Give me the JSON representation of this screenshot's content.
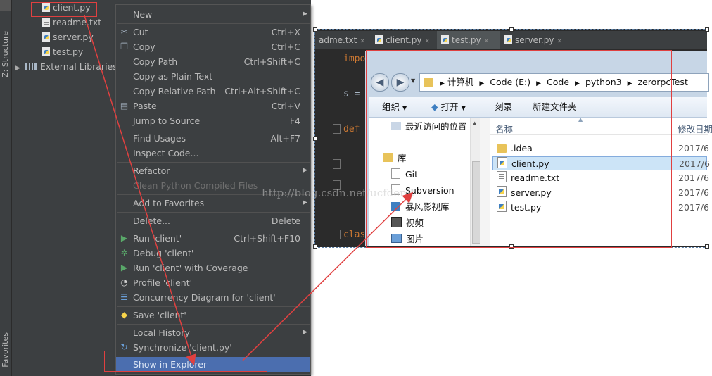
{
  "project_tree": {
    "items": [
      {
        "label": "client.py",
        "icon": "python-file-icon"
      },
      {
        "label": "readme.txt",
        "icon": "text-file-icon"
      },
      {
        "label": "server.py",
        "icon": "python-file-icon"
      },
      {
        "label": "test.py",
        "icon": "python-file-icon"
      },
      {
        "label": "External Libraries",
        "icon": "library-icon"
      }
    ]
  },
  "side_tabs": {
    "structure": "Z: Structure",
    "favorites": "Favorites"
  },
  "context_menu": {
    "items": [
      {
        "label": "New",
        "shortcut": "",
        "submenu": true
      },
      {
        "label": "Cut",
        "shortcut": "Ctrl+X",
        "icon": "scissors-icon"
      },
      {
        "label": "Copy",
        "shortcut": "Ctrl+C",
        "icon": "copy-icon"
      },
      {
        "label": "Copy Path",
        "shortcut": "Ctrl+Shift+C"
      },
      {
        "label": "Copy as Plain Text",
        "shortcut": ""
      },
      {
        "label": "Copy Relative Path",
        "shortcut": "Ctrl+Alt+Shift+C"
      },
      {
        "label": "Paste",
        "shortcut": "Ctrl+V",
        "icon": "paste-icon"
      },
      {
        "label": "Jump to Source",
        "shortcut": "F4"
      },
      {
        "label": "Find Usages",
        "shortcut": "Alt+F7"
      },
      {
        "label": "Inspect Code...",
        "shortcut": ""
      },
      {
        "label": "Refactor",
        "shortcut": "",
        "submenu": true
      },
      {
        "label": "Clean Python Compiled Files",
        "shortcut": "",
        "disabled": true
      },
      {
        "label": "Add to Favorites",
        "shortcut": "",
        "submenu": true
      },
      {
        "label": "Delete...",
        "shortcut": "Delete"
      },
      {
        "label": "Run 'client'",
        "shortcut": "Ctrl+Shift+F10",
        "icon": "run-icon"
      },
      {
        "label": "Debug 'client'",
        "shortcut": "",
        "icon": "debug-icon"
      },
      {
        "label": "Run 'client' with Coverage",
        "shortcut": "",
        "icon": "coverage-icon"
      },
      {
        "label": "Profile 'client'",
        "shortcut": "",
        "icon": "profile-icon"
      },
      {
        "label": "Concurrency Diagram for  'client'",
        "shortcut": "",
        "icon": "concurrency-icon"
      },
      {
        "label": "Save 'client'",
        "shortcut": "",
        "icon": "python-icon"
      },
      {
        "label": "Local History",
        "shortcut": "",
        "submenu": true
      },
      {
        "label": "Synchronize 'client.py'",
        "shortcut": "",
        "icon": "sync-icon"
      },
      {
        "label": "Show in Explorer",
        "shortcut": "",
        "selected": true
      }
    ]
  },
  "editor": {
    "tabs": [
      {
        "label": "adme.txt",
        "icon": "text-file-icon"
      },
      {
        "label": "client.py",
        "icon": "python-file-icon"
      },
      {
        "label": "test.py",
        "icon": "python-file-icon",
        "active": true
      },
      {
        "label": "server.py",
        "icon": "python-file-icon"
      }
    ],
    "code_fragments": [
      "impo",
      "s =",
      "def",
      "clas"
    ]
  },
  "explorer": {
    "breadcrumb": [
      "计算机",
      "Code (E:)",
      "Code",
      "python3",
      "zerorpcTest"
    ],
    "toolbar": {
      "organize": "组织",
      "open": "打开",
      "burn": "刻录",
      "new_folder": "新建文件夹"
    },
    "nav_items": [
      {
        "label": "最近访问的位置",
        "icon": "recent-places-icon"
      },
      {
        "label": "库",
        "icon": "library-folder-icon"
      },
      {
        "label": "Git",
        "icon": "document-icon"
      },
      {
        "label": "Subversion",
        "icon": "document-icon"
      },
      {
        "label": "暴风影视库",
        "icon": "video-library-icon"
      },
      {
        "label": "视频",
        "icon": "video-icon"
      },
      {
        "label": "图片",
        "icon": "picture-icon"
      }
    ],
    "column_name": "名称",
    "column_date": "修改日期",
    "files": [
      {
        "name": ".idea",
        "date": "2017/6",
        "type": "folder"
      },
      {
        "name": "client.py",
        "date": "2017/6",
        "type": "py",
        "selected": true
      },
      {
        "name": "readme.txt",
        "date": "2017/6",
        "type": "txt"
      },
      {
        "name": "server.py",
        "date": "2017/6",
        "type": "py"
      },
      {
        "name": "test.py",
        "date": "2017/6",
        "type": "py"
      }
    ]
  },
  "watermark": "http://blog.csdn.net/ucfdenR",
  "colors": {
    "ide_bg": "#3c3f41",
    "menu_selected": "#4b6eaf",
    "annotation_red": "#e04040",
    "editor_bg": "#2b2b2b"
  }
}
